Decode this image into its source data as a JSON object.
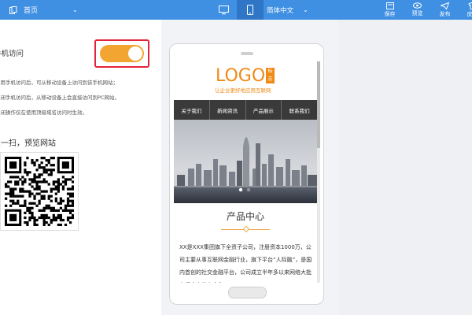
{
  "toolbar": {
    "page_select": "首页",
    "language_select": "简体中文",
    "actions": [
      {
        "label": "保存",
        "icon": "save-icon"
      },
      {
        "label": "预览",
        "icon": "eye-icon"
      },
      {
        "label": "发布",
        "icon": "send-icon"
      },
      {
        "label": "皮肤",
        "icon": "skin-icon"
      }
    ],
    "accent_color": "#3f8fe3"
  },
  "settings": {
    "mobile_access_label": "手机访问",
    "toggle_on": true,
    "notes": [
      "启用手机访问后，可从移动设备上访问到该手机网站；",
      "关闭手机访问后，从移动设备上会直接访问到PC网站。",
      "关闭操作仅在使用顶级域名访问时生效。"
    ],
    "qr_title": "扫一扫，预览网站"
  },
  "preview": {
    "logo_text": "LOGO",
    "logo_badge": "标志",
    "logo_tagline": "让企业更好地应用互联网",
    "nav": [
      "关于我们",
      "新闻资讯",
      "产品展示",
      "联系我们"
    ],
    "section_title": "产品中心",
    "body_text": "XX是XXX集团旗下全资子公司，注册资本1000万，公司主要从事互联网金融行业，旗下平台“人际融”，是国内首创的社交金融平台，公司成立半年多以来网络大批有识之士前来合作，"
  }
}
